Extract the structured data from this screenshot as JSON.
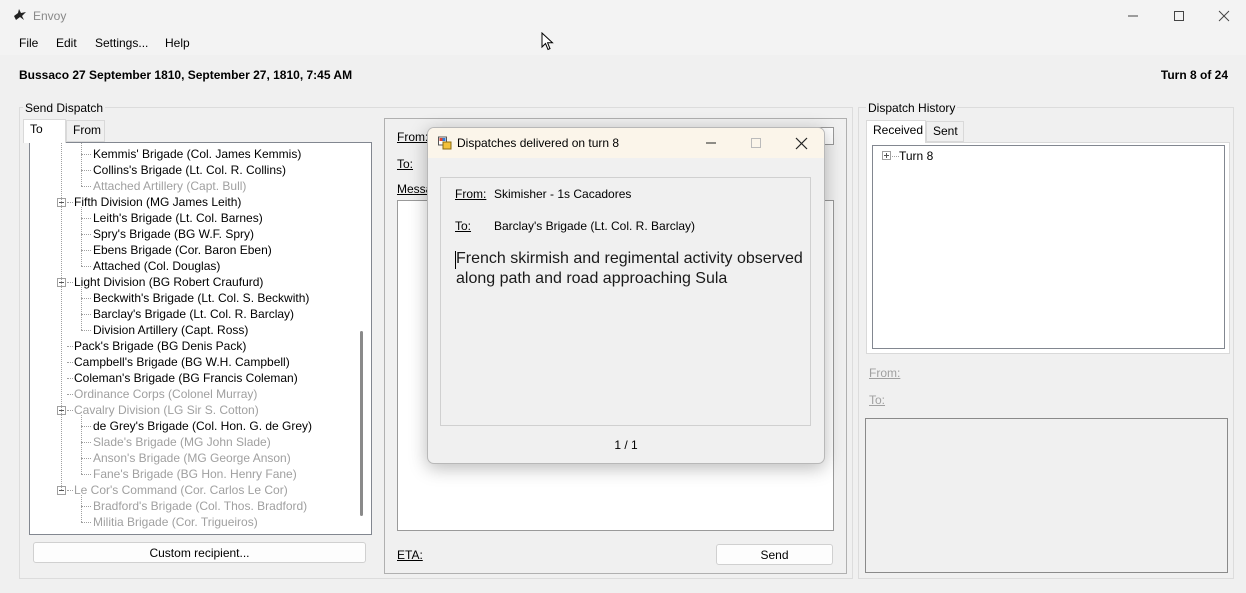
{
  "window": {
    "title": "Envoy"
  },
  "menu": {
    "items": [
      "File",
      "Edit",
      "Settings...",
      "Help"
    ]
  },
  "header": {
    "scenario": "Bussaco 27 September 1810, September 27, 1810, 7:45 AM",
    "turn": "Turn 8 of 24"
  },
  "send_dispatch": {
    "title": "Send Dispatch",
    "tabs": [
      "To",
      "From"
    ],
    "active_tab": "To",
    "tree": [
      {
        "label": "Kemmis' Brigade (Col. James Kemmis)",
        "level": 2,
        "enabled": true
      },
      {
        "label": "Collins's Brigade (Lt. Col. R. Collins)",
        "level": 2,
        "enabled": true
      },
      {
        "label": "Attached Artillery (Capt. Bull)",
        "level": 2,
        "enabled": false
      },
      {
        "label": "Fifth Division (MG James Leith)",
        "level": 1,
        "enabled": true,
        "expanded": true
      },
      {
        "label": "Leith's Brigade (Lt. Col. Barnes)",
        "level": 2,
        "enabled": true
      },
      {
        "label": "Spry's Brigade (BG W.F. Spry)",
        "level": 2,
        "enabled": true
      },
      {
        "label": "Ebens Brigade (Cor. Baron Eben)",
        "level": 2,
        "enabled": true
      },
      {
        "label": "Attached (Col. Douglas)",
        "level": 2,
        "enabled": true
      },
      {
        "label": "Light Division (BG Robert Craufurd)",
        "level": 1,
        "enabled": true,
        "expanded": true
      },
      {
        "label": "Beckwith's Brigade (Lt. Col. S. Beckwith)",
        "level": 2,
        "enabled": true
      },
      {
        "label": "Barclay's Brigade (Lt. Col. R. Barclay)",
        "level": 2,
        "enabled": true
      },
      {
        "label": "Division Artillery (Capt. Ross)",
        "level": 2,
        "enabled": true
      },
      {
        "label": "Pack's Brigade (BG Denis Pack)",
        "level": 1,
        "enabled": true
      },
      {
        "label": "Campbell's Brigade (BG W.H. Campbell)",
        "level": 1,
        "enabled": true
      },
      {
        "label": "Coleman's Brigade (BG Francis Coleman)",
        "level": 1,
        "enabled": true
      },
      {
        "label": "Ordinance Corps (Colonel Murray)",
        "level": 1,
        "enabled": false
      },
      {
        "label": "Cavalry Division (LG Sir S. Cotton)",
        "level": 1,
        "enabled": false,
        "expanded": true
      },
      {
        "label": "de Grey's Brigade (Col. Hon. G. de Grey)",
        "level": 2,
        "enabled": true
      },
      {
        "label": "Slade's Brigade (MG John Slade)",
        "level": 2,
        "enabled": false
      },
      {
        "label": "Anson's Brigade (MG George Anson)",
        "level": 2,
        "enabled": false
      },
      {
        "label": "Fane's Brigade (BG Hon. Henry Fane)",
        "level": 2,
        "enabled": false
      },
      {
        "label": "Le Cor's Command (Cor. Carlos Le Cor)",
        "level": 1,
        "enabled": false,
        "expanded": true
      },
      {
        "label": "Bradford's Brigade (Col. Thos. Bradford)",
        "level": 2,
        "enabled": false
      },
      {
        "label": "Militia Brigade (Cor. Trigueiros)",
        "level": 2,
        "enabled": false
      }
    ],
    "custom_recipient_label": "Custom recipient...",
    "compose": {
      "from_label": "From:",
      "to_label": "To:",
      "message_label": "Messa",
      "eta_label": "ETA:",
      "send_label": "Send"
    }
  },
  "history": {
    "title": "Dispatch History",
    "tabs": [
      "Received",
      "Sent"
    ],
    "active_tab": "Received",
    "tree": [
      {
        "label": "Turn 8"
      }
    ],
    "from_label": "From:",
    "to_label": "To:"
  },
  "modal": {
    "title": "Dispatches delivered on turn 8",
    "from_label": "From:",
    "from_value": "Skimisher - 1s Cacadores",
    "to_label": "To:",
    "to_value": "Barclay's Brigade (Lt. Col. R. Barclay)",
    "message": "French skirmish and regimental activity observed along path and road approaching Sula",
    "pager": "1 / 1"
  }
}
